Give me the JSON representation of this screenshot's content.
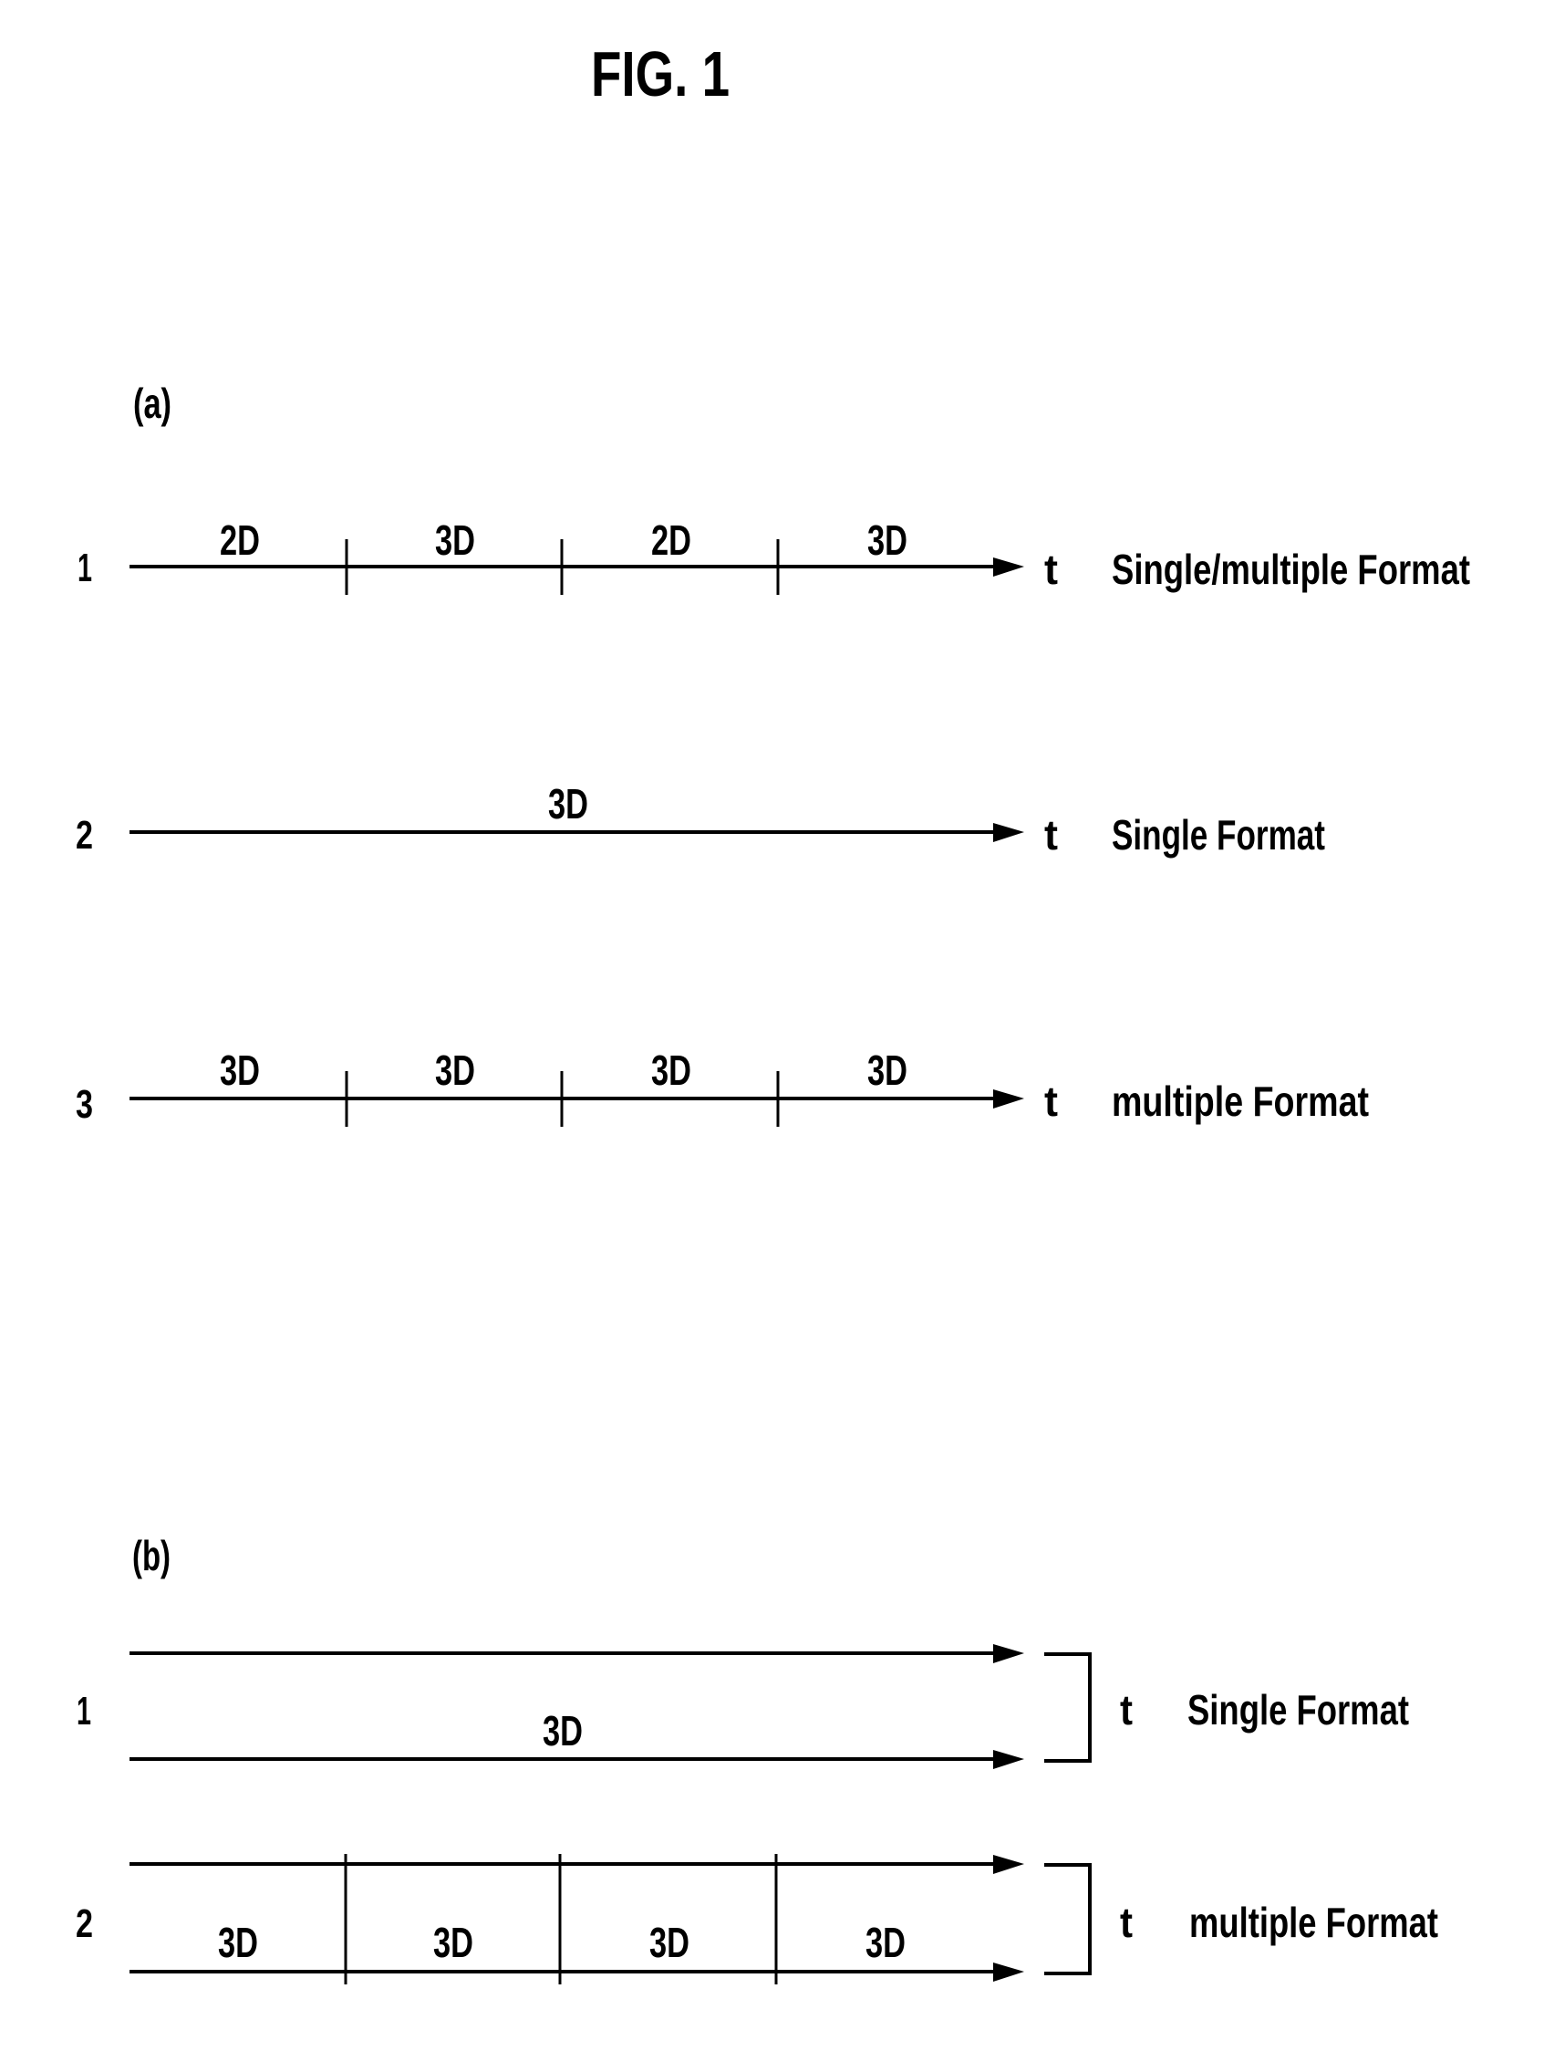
{
  "figure": {
    "title": "FIG. 1",
    "colors": {
      "ink": "#000000",
      "background": "#ffffff"
    }
  },
  "panel_a": {
    "label": "(a)",
    "axis_label": "t",
    "rows": [
      {
        "number": "1",
        "segments": [
          "2D",
          "3D",
          "2D",
          "3D"
        ],
        "description": "Single/multiple Format"
      },
      {
        "number": "2",
        "segments": [
          "3D"
        ],
        "description": "Single Format"
      },
      {
        "number": "3",
        "segments": [
          "3D",
          "3D",
          "3D",
          "3D"
        ],
        "description": "multiple Format"
      }
    ]
  },
  "panel_b": {
    "label": "(b)",
    "axis_label": "t",
    "rows": [
      {
        "number": "1",
        "segments": [
          "3D"
        ],
        "streams": 2,
        "description": "Single Format"
      },
      {
        "number": "2",
        "segments": [
          "3D",
          "3D",
          "3D",
          "3D"
        ],
        "streams": 2,
        "description": "multiple Format"
      }
    ]
  }
}
